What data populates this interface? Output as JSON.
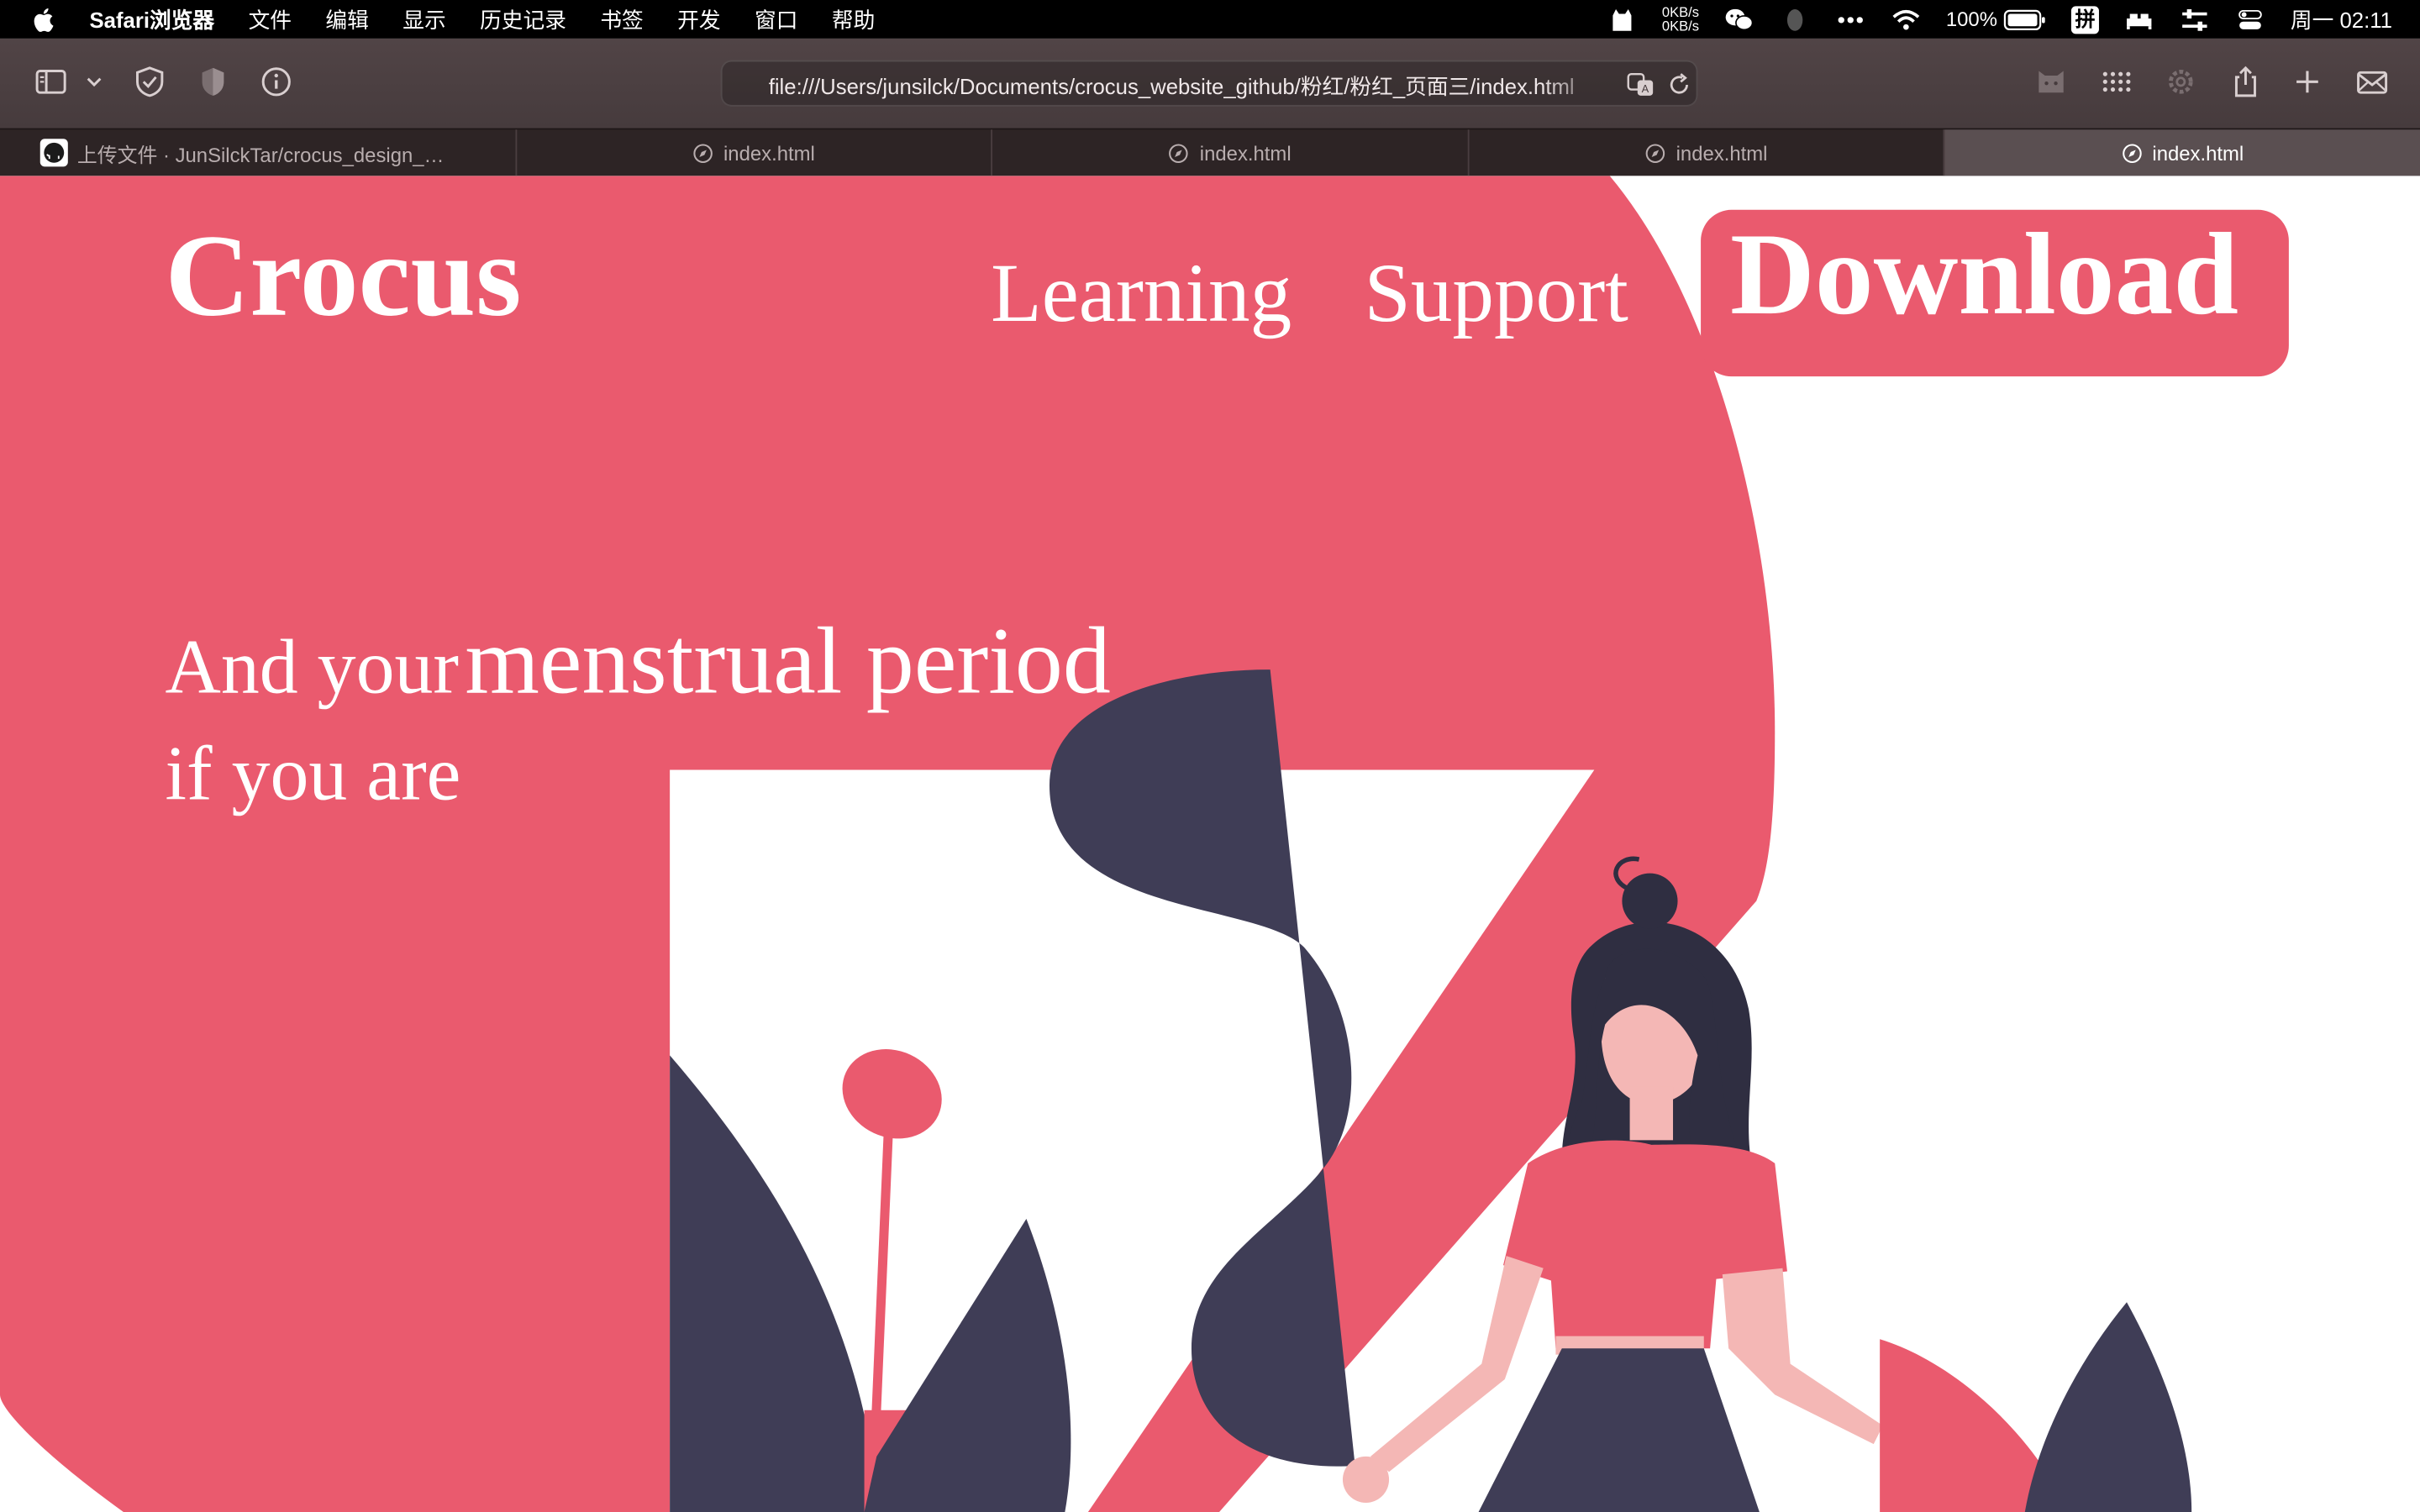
{
  "menubar": {
    "app_name": "Safari浏览器",
    "menus": [
      "文件",
      "编辑",
      "显示",
      "历史记录",
      "书签",
      "开发",
      "窗口",
      "帮助"
    ],
    "net_up": "0KB/s",
    "net_down": "0KB/s",
    "battery": "100%",
    "input_method": "拼",
    "clock": "周一 02:11",
    "icons": [
      "apple-logo",
      "cat-icon",
      "wechat-icon",
      "qq-icon",
      "more-icon",
      "wifi-icon",
      "battery-icon",
      "input-method-icon",
      "bed-icon",
      "sliders-icon",
      "control-center-icon"
    ]
  },
  "toolbar": {
    "url": "file:///Users/junsilck/Documents/crocus_website_github/粉红/粉红_页面三/index.html",
    "icons": [
      "sidebar-icon",
      "chevron-down-icon",
      "shield-check-icon",
      "privacy-shield-icon",
      "info-icon",
      "translate-icon",
      "reload-icon",
      "extension-icon",
      "grid-icon",
      "gear-icon",
      "share-icon",
      "plus-icon",
      "mail-icon"
    ]
  },
  "tabs": [
    {
      "label": "上传文件 · JunSilckTar/crocus_design_mo...",
      "active": false
    },
    {
      "label": "index.html",
      "active": false
    },
    {
      "label": "index.html",
      "active": false
    },
    {
      "label": "index.html",
      "active": false
    },
    {
      "label": "index.html",
      "active": true
    }
  ],
  "site": {
    "logo": "Crocus",
    "nav": {
      "learning": "Learning",
      "support": "Support",
      "download": "Download"
    },
    "headline": {
      "part1": "And your",
      "part2": "menstrual period",
      "line2": "if you are"
    }
  },
  "colors": {
    "brand_pink": "#ea5a6e",
    "dark_navy": "#3f3d56",
    "skin": "#f4b7b5",
    "hair": "#2f2e41",
    "white": "#ffffff"
  }
}
